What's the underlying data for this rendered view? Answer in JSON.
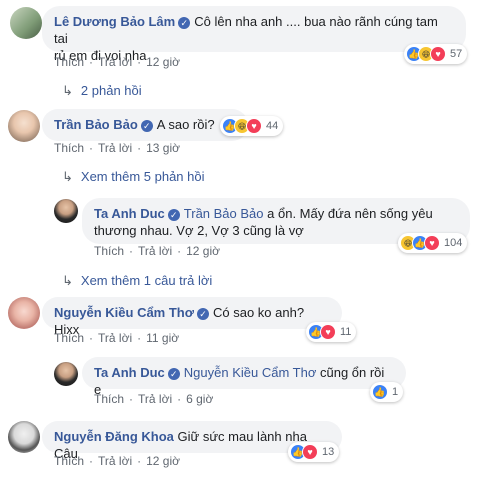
{
  "comments": [
    {
      "author": "Lê Dương Bảo Lâm",
      "text": "Cô lên nha anh .... bua nào rãnh cúng tam tai rủ em đi voi nha",
      "text_line1": "Cô lên nha anh .... bua nào rãnh cúng tam tai",
      "text_line2": "rủ em đi voi nha",
      "like": "Thích",
      "reply": "Trả lời",
      "time": "12 giờ",
      "reaction_count": "57"
    },
    {
      "author": "Trần Bảo Bảo",
      "text": "A sao rồi?",
      "like": "Thích",
      "reply": "Trả lời",
      "time": "13 giờ",
      "reaction_count": "44"
    },
    {
      "author": "Ta Anh Duc",
      "tag": "Trần Bảo Bảo",
      "text_line1": "a ổn. Mấy đứa nên sống yêu",
      "text_line2": "thương nhau. Vợ 2, Vợ 3 cũng là vợ",
      "like": "Thích",
      "reply": "Trả lời",
      "time": "12 giờ",
      "reaction_count": "104"
    },
    {
      "author": "Nguyễn Kiều Cẩm Thơ",
      "text": "Có sao ko anh? Hixx",
      "like": "Thích",
      "reply": "Trả lời",
      "time": "11 giờ",
      "reaction_count": "11"
    },
    {
      "author": "Ta Anh Duc",
      "tag": "Nguyễn Kiều Cẩm Thơ",
      "text": "cũng ổn rồi e",
      "like": "Thích",
      "reply": "Trả lời",
      "time": "6 giờ",
      "reaction_count": "1"
    },
    {
      "author": "Nguyễn Đăng Khoa",
      "text": "Giữ sức mau lành nha Câu",
      "like": "Thích",
      "reply": "Trả lời",
      "time": "12 giờ",
      "reaction_count": "13"
    }
  ],
  "reply_links": {
    "r1": "2 phản hồi",
    "r2": "Xem thêm 5 phản hồi",
    "r3": "Xem thêm 1 câu trả lời"
  },
  "colors": {
    "link": "#385898",
    "bubble": "#f2f3f5",
    "meta": "#606770",
    "like": "#3b82f6",
    "love": "#f33e58",
    "haha": "#f7c531"
  }
}
